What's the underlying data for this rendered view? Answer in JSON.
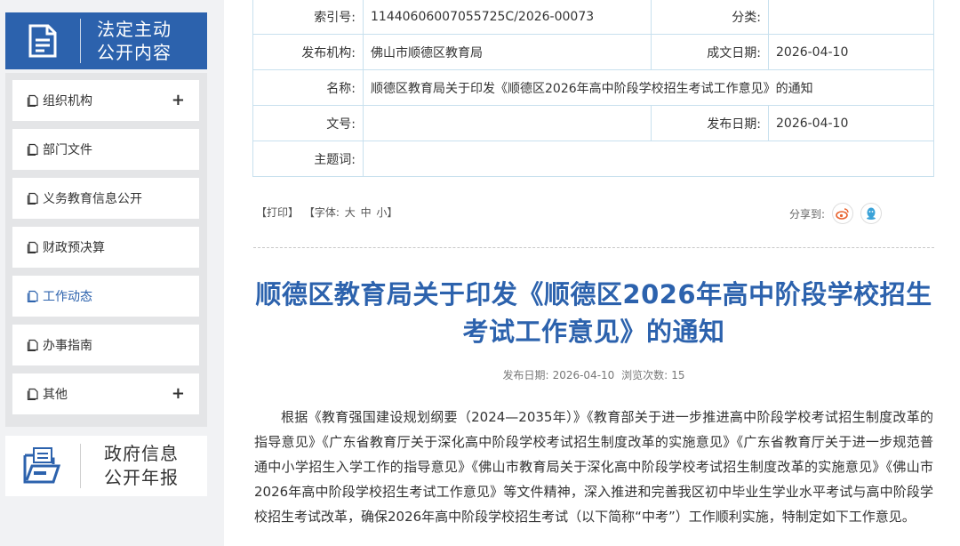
{
  "sidebar": {
    "banner_title_line1": "法定主动",
    "banner_title_line2": "公开内容",
    "menu": [
      {
        "label": "组织机构",
        "has_plus": true
      },
      {
        "label": "部门文件",
        "has_plus": false
      },
      {
        "label": "义务教育信息公开",
        "has_plus": false
      },
      {
        "label": "财政预决算",
        "has_plus": false
      },
      {
        "label": "工作动态",
        "has_plus": false,
        "active": true
      },
      {
        "label": "办事指南",
        "has_plus": false
      },
      {
        "label": "其他",
        "has_plus": true
      }
    ],
    "plus_symbol": "+",
    "annual_line1": "政府信息",
    "annual_line2": "公开年报"
  },
  "meta": {
    "index_label": "索引号:",
    "index_value": "11440606007055725C/2026-00073",
    "category_label": "分类:",
    "category_value": "",
    "publisher_label": "发布机构:",
    "publisher_value": "佛山市顺德区教育局",
    "created_label": "成文日期:",
    "created_value": "2026-04-10",
    "name_label": "名称:",
    "name_value": "顺德区教育局关于印发《顺德区2026年高中阶段学校招生考试工作意见》的通知",
    "docno_label": "文号:",
    "docno_value": "",
    "pubdate_label": "发布日期:",
    "pubdate_value": "2026-04-10",
    "subject_label": "主题词:",
    "subject_value": ""
  },
  "tools": {
    "print": "【打印】",
    "font_label": "【字体:",
    "font_large": "大",
    "font_medium": "中",
    "font_small": "小】",
    "share_label": "分享到:"
  },
  "article": {
    "title": "顺德区教育局关于印发《顺德区2026年高中阶段学校招生考试工作意见》的通知",
    "pub_date_label": "发布日期:",
    "pub_date": "2026-04-10",
    "views_label": "浏览次数:",
    "views": "15",
    "paragraph": "根据《教育强国建设规划纲要（2024—2035年）》《教育部关于进一步推进高中阶段学校考试招生制度改革的指导意见》《广东省教育厅关于深化高中阶段学校考试招生制度改革的实施意见》《广东省教育厅关于进一步规范普通中小学招生入学工作的指导意见》《佛山市教育局关于深化高中阶段学校考试招生制度改革的实施意见》《佛山市2026年高中阶段学校招生考试工作意见》等文件精神，深入推进和完善我区初中毕业生学业水平考试与高中阶段学校招生考试改革，确保2026年高中阶段学校招生考试（以下简称“中考”）工作顺利实施，特制定如下工作意见。"
  },
  "colors": {
    "brand_blue": "#2c62ad",
    "weibo_orange": "#e8632f",
    "qq_blue": "#3aa2d8"
  }
}
